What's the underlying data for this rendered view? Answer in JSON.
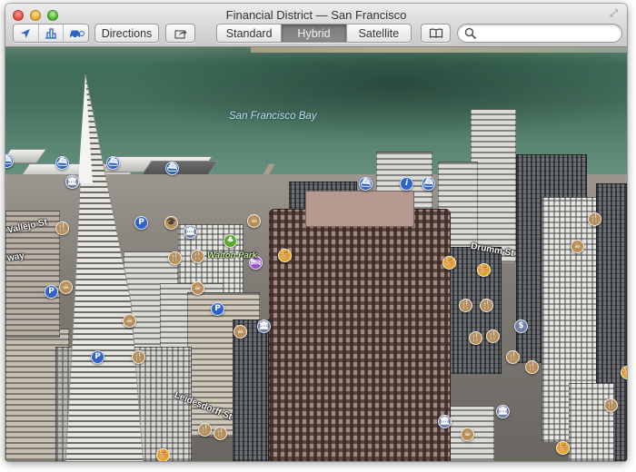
{
  "window": {
    "title": "Financial District — San Francisco"
  },
  "toolbar": {
    "tracking_icon": "location-arrow-icon",
    "buildings_icon": "3d-buildings-icon",
    "traffic_icon": "car-traffic-icon",
    "directions_label": "Directions",
    "share_icon": "share-icon",
    "map_types": [
      {
        "label": "Standard",
        "active": false
      },
      {
        "label": "Hybrid",
        "active": true
      },
      {
        "label": "Satellite",
        "active": false
      }
    ],
    "bookmarks_icon": "bookmarks-book-icon",
    "search": {
      "value": "",
      "placeholder": ""
    }
  },
  "map": {
    "water_label": "San Francisco Bay",
    "street_labels": [
      "Vallejo St",
      "way",
      "Drumm St",
      "Leidesdorff St"
    ],
    "park_label": "Walton Park",
    "colors": {
      "poi_blue": "#2f63c9",
      "poi_food": "#b88e58",
      "poi_shopping": "#e3a820",
      "poi_civic": "#6f7fa8",
      "poi_park": "#5aa830",
      "poi_hotel": "#9b55c8"
    }
  }
}
